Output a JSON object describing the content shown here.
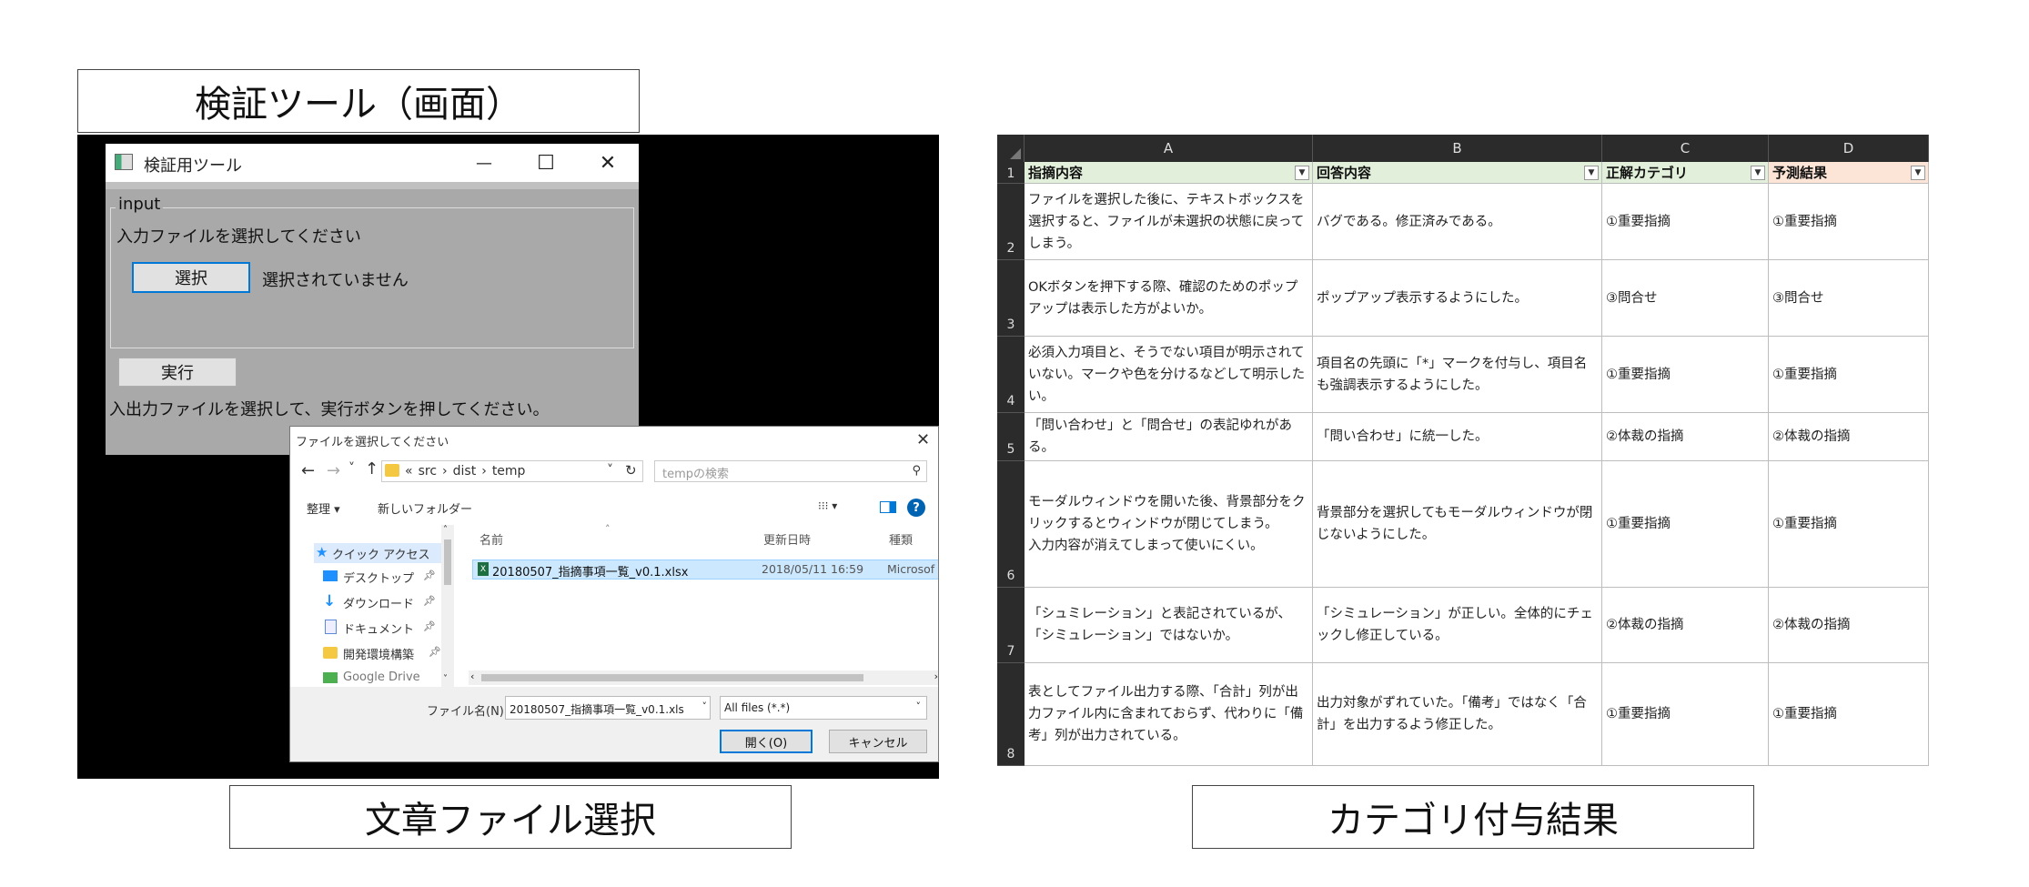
{
  "captions": {
    "tool_screen": "検証ツール（画面）",
    "file_select": "文章ファイル選択",
    "category_result": "カテゴリ付与結果"
  },
  "tool_window": {
    "title": "検証用ツール",
    "minimize": "—",
    "maximize": "☐",
    "close": "✕",
    "group_label": "input",
    "prompt": "入力ファイルを選択してください",
    "select_button": "選択",
    "selection_status": "選択されていません",
    "run_button": "実行",
    "instruction": "入出力ファイルを選択して、実行ボタンを押してください。"
  },
  "file_dialog": {
    "title": "ファイルを選択してください",
    "close": "✕",
    "nav": {
      "back": "←",
      "forward": "→",
      "recent": "˅",
      "up": "↑"
    },
    "breadcrumb": [
      "«",
      "src",
      "›",
      "dist",
      "›",
      "temp"
    ],
    "refresh": "↻",
    "search_placeholder": "tempの検索",
    "organize": "整理 ▾",
    "new_folder": "新しいフォルダー",
    "view_menu": "⁝⁝⁝ ▾",
    "help": "?",
    "sidebar": [
      {
        "label": "クイック アクセス",
        "icon": "star-icon"
      },
      {
        "label": "デスクトップ",
        "icon": "desktop-icon"
      },
      {
        "label": "ダウンロード",
        "icon": "download-icon"
      },
      {
        "label": "ドキュメント",
        "icon": "document-icon"
      },
      {
        "label": "開発環境構築",
        "icon": "folder-icon"
      },
      {
        "label": "Google Drive",
        "icon": "drive-icon"
      }
    ],
    "columns": {
      "name": "名前",
      "modified": "更新日時",
      "type": "種類"
    },
    "files": [
      {
        "name": "20180507_指摘事項一覧_v0.1.xlsx",
        "modified": "2018/05/11 16:59",
        "type": "Microsof"
      }
    ],
    "filename_label": "ファイル名(N):",
    "filename_value": "20180507_指摘事項一覧_v0.1.xls",
    "filter_value": "All files (*.*)",
    "open_button": "開く(O)",
    "cancel_button": "キャンセル",
    "colors": {
      "selected_row": "#cce8ff",
      "accent": "#0078d7"
    }
  },
  "sheet": {
    "col_letters": [
      "A",
      "B",
      "C",
      "D"
    ],
    "headers": [
      "指摘内容",
      "回答内容",
      "正解カテゴリ",
      "予測結果"
    ],
    "header_colors": [
      "#e2efda",
      "#e2efda",
      "#e2efda",
      "#fce4d6"
    ],
    "header_row_number": "1",
    "rows": [
      {
        "num": "2",
        "a": "ファイルを選択した後に、テキストボックスを選択すると、ファイルが未選択の状態に戻ってしまう。",
        "b": "バグである。修正済みである。",
        "c": "①重要指摘",
        "d": "①重要指摘"
      },
      {
        "num": "3",
        "a": "OKボタンを押下する際、確認のためのポップアップは表示した方がよいか。",
        "b": "ポップアップ表示するようにした。",
        "c": "③問合せ",
        "d": "③問合せ"
      },
      {
        "num": "4",
        "a": "必須入力項目と、そうでない項目が明示されていない。マークや色を分けるなどして明示したい。",
        "b": "項目名の先頭に「*」マークを付与し、項目名も強調表示するようにした。",
        "c": "①重要指摘",
        "d": "①重要指摘"
      },
      {
        "num": "5",
        "a": "「問い合わせ」と「問合せ」の表記ゆれがある。",
        "b": "「問い合わせ」に統一した。",
        "c": "②体裁の指摘",
        "d": "②体裁の指摘"
      },
      {
        "num": "6",
        "a": "モーダルウィンドウを開いた後、背景部分をクリックするとウィンドウが閉じてしまう。\n入力内容が消えてしまって使いにくい。",
        "b": "背景部分を選択してもモーダルウィンドウが閉じないようにした。",
        "c": "①重要指摘",
        "d": "①重要指摘"
      },
      {
        "num": "7",
        "a": "「シュミレーション」と表記されているが、「シミュレーション」ではないか。",
        "b": "「シミュレーション」が正しい。全体的にチェックし修正している。",
        "c": "②体裁の指摘",
        "d": "②体裁の指摘"
      },
      {
        "num": "8",
        "a": "表としてファイル出力する際、「合計」列が出力ファイル内に含まれておらず、代わりに「備考」列が出力されている。",
        "b": "出力対象がずれていた。「備考」ではなく「合計」を出力するよう修正した。",
        "c": "①重要指摘",
        "d": "①重要指摘"
      }
    ]
  }
}
